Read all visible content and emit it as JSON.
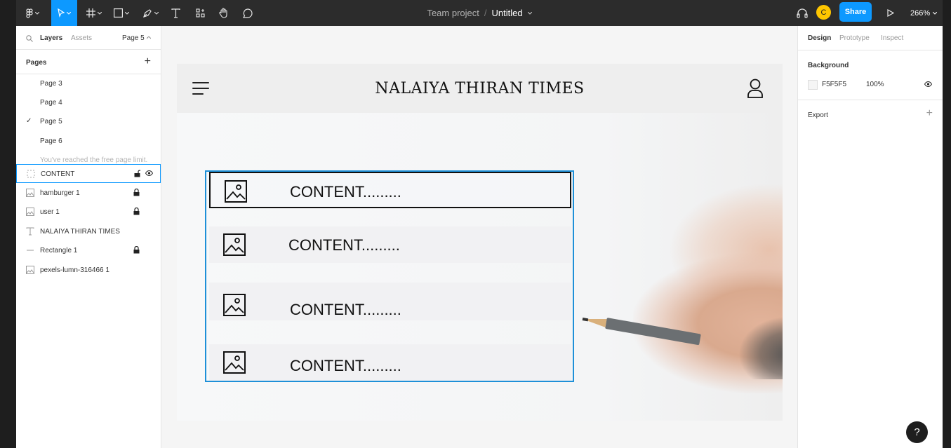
{
  "toolbar": {
    "project": "Team project",
    "separator": "/",
    "document": "Untitled",
    "avatar_initial": "C",
    "share_label": "Share",
    "zoom": "266%",
    "accent": "#0d99ff"
  },
  "left_panel": {
    "tabs": {
      "layers": "Layers",
      "assets": "Assets",
      "page_selector": "Page 5"
    },
    "pages_label": "Pages",
    "pages": [
      "Page 3",
      "Page 4",
      "Page 5",
      "Page 6"
    ],
    "current_page": "Page 5",
    "limit_note": "You've reached the free page limit.",
    "layers": [
      {
        "name": "CONTENT",
        "icon": "group-icon",
        "locked": false,
        "selected": true
      },
      {
        "name": "hamburger 1",
        "icon": "image-icon",
        "locked": true
      },
      {
        "name": "user 1",
        "icon": "image-icon",
        "locked": true
      },
      {
        "name": "NALAIYA THIRAN TIMES",
        "icon": "text-icon",
        "locked": false
      },
      {
        "name": "Rectangle 1",
        "icon": "rectangle-icon",
        "locked": true
      },
      {
        "name": "pexels-lumn-316466 1",
        "icon": "image-icon",
        "locked": false
      }
    ]
  },
  "canvas": {
    "site_title": "NALAIYA THIRAN TIMES",
    "content_rows": [
      "CONTENT.........",
      "CONTENT.........",
      "CONTENT.........",
      "CONTENT........."
    ]
  },
  "right_panel": {
    "tabs": {
      "design": "Design",
      "prototype": "Prototype",
      "inspect": "Inspect"
    },
    "background_title": "Background",
    "bg_hex": "F5F5F5",
    "bg_opacity": "100%",
    "export_title": "Export"
  },
  "help_label": "?"
}
